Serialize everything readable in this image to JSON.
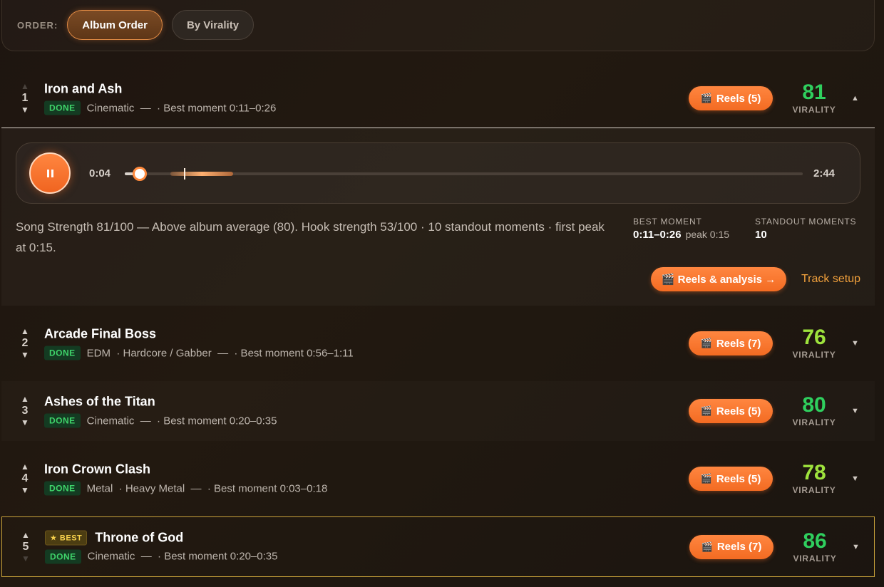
{
  "order": {
    "label": "ORDER:",
    "options": [
      "Album Order",
      "By Virality"
    ],
    "active": "Album Order"
  },
  "player": {
    "current_time": "0:04",
    "duration": "2:44",
    "progress_fraction": 0.024,
    "state": "playing"
  },
  "expanded": {
    "analysis_text": "Song Strength 81/100 — Above album average (80). Hook strength 53/100 · 10 standout moments · first peak at 0:15.",
    "best_moment_label": "BEST MOMENT",
    "best_moment_value": "0:11–0:26",
    "best_moment_peak": "peak 0:15",
    "standout_label": "STANDOUT MOMENTS",
    "standout_value": "10",
    "analysis_button": "🎬 Reels & analysis →",
    "setup_link": "Track setup"
  },
  "virality_label": "VIRALITY",
  "tracks": [
    {
      "num": "1",
      "title": "Iron and Ash",
      "status": "DONE",
      "meta": "Cinematic  —  · Best moment 0:11–0:26",
      "reels": "Reels (5)",
      "virality": "81",
      "color": "#2fcf5e",
      "chevron": "▲"
    },
    {
      "num": "2",
      "title": "Arcade Final Boss",
      "status": "DONE",
      "meta": "EDM  · Hardcore / Gabber  —  · Best moment 0:56–1:11",
      "reels": "Reels (7)",
      "virality": "76",
      "color": "#9ee33d",
      "chevron": "▼"
    },
    {
      "num": "3",
      "title": "Ashes of the Titan",
      "status": "DONE",
      "meta": "Cinematic  —  · Best moment 0:20–0:35",
      "reels": "Reels (5)",
      "virality": "80",
      "color": "#2fcf5e",
      "chevron": "▼"
    },
    {
      "num": "4",
      "title": "Iron Crown Clash",
      "status": "DONE",
      "meta": "Metal  · Heavy Metal  —  · Best moment 0:03–0:18",
      "reels": "Reels (5)",
      "virality": "78",
      "color": "#9ee33d",
      "chevron": "▼"
    },
    {
      "num": "5",
      "title": "Throne of God",
      "badge": "★ BEST",
      "status": "DONE",
      "meta": "Cinematic  —  · Best moment 0:20–0:35",
      "reels": "Reels (7)",
      "virality": "86",
      "color": "#2fcf5e",
      "chevron": "▼"
    }
  ]
}
